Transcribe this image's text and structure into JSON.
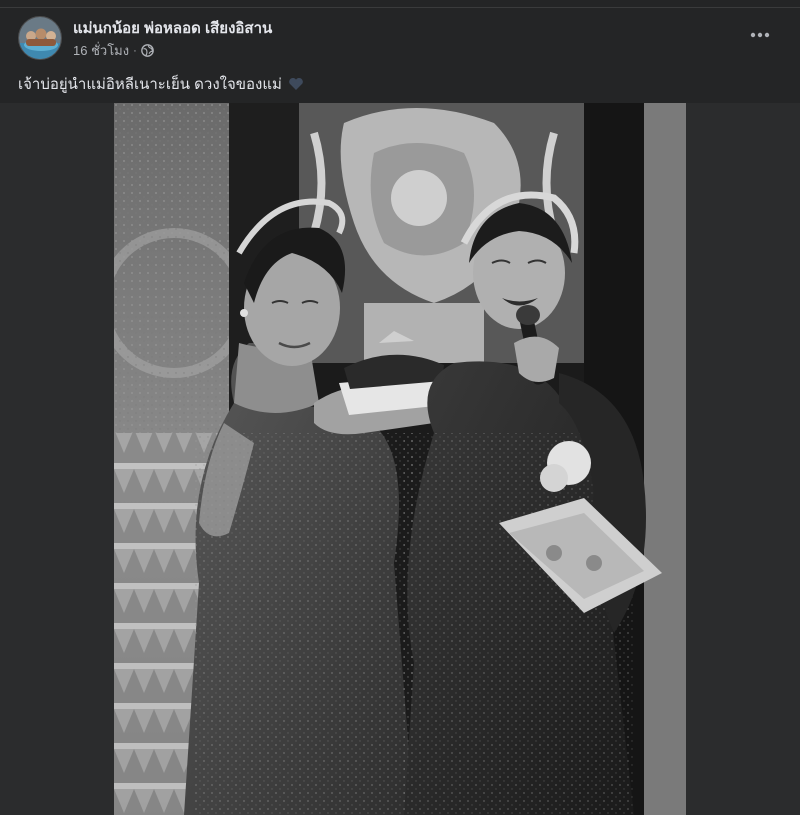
{
  "post": {
    "author": "แม่นกน้อย พ่อหลอด เสียงอิสาน",
    "time": "16 ชั่วโมง",
    "separator": "·",
    "privacy_icon": "globe-icon",
    "caption": "เจ้าบ่อยู่นำแม่อิหลีเนาะเย็น ดวงใจของแม่",
    "caption_emoji": "heart-icon",
    "more_icon": "more-options-icon"
  },
  "colors": {
    "background": "#242526",
    "text_primary": "#e4e6eb",
    "text_secondary": "#b0b3b8",
    "heart": "#3e4a5c"
  },
  "photo": {
    "style": "black-and-white"
  }
}
